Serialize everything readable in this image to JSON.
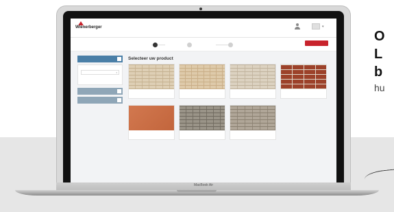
{
  "promo": {
    "line1": "O",
    "line2": "L",
    "line3": "b",
    "line4": "hu"
  },
  "laptop": {
    "model_label": "MacBook Air"
  },
  "app": {
    "logo_text": "Wienerberger",
    "user_label": "",
    "next_button": "",
    "steps": [
      {
        "num": "",
        "label": "",
        "active": true
      },
      {
        "num": "",
        "label": "",
        "active": false
      },
      {
        "num": "",
        "label": "",
        "active": false
      }
    ],
    "sidebar": {
      "filter_header": "",
      "filter_caption": "",
      "filter_select": "",
      "header2": "",
      "header3": ""
    },
    "main_title": "Selecteer uw product",
    "products": [
      {
        "name": "",
        "sub": "",
        "swatch": "beige"
      },
      {
        "name": "",
        "sub": "",
        "swatch": "sand"
      },
      {
        "name": "",
        "sub": "",
        "swatch": "light"
      },
      {
        "name": "",
        "sub": "",
        "swatch": "red"
      },
      {
        "name": "",
        "sub": "",
        "swatch": "orange"
      },
      {
        "name": "",
        "sub": "",
        "swatch": "grey"
      },
      {
        "name": "",
        "sub": "",
        "swatch": "stone"
      }
    ]
  },
  "colors": {
    "accent_red": "#c8232c",
    "sidebar_blue": "#4a7fa7",
    "band_grey": "#e6e6e6"
  }
}
